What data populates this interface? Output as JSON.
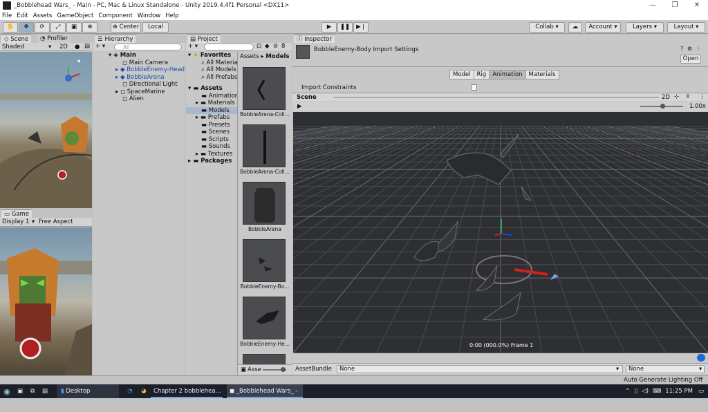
{
  "window": {
    "title": "_Bobblehead Wars_ - Main - PC, Mac & Linux Standalone - Unity 2019.4.4f1 Personal <DX11>",
    "controls": [
      "—",
      "❐",
      "✕"
    ]
  },
  "menu": [
    "File",
    "Edit",
    "Assets",
    "GameObject",
    "Component",
    "Window",
    "Help"
  ],
  "toolbar": {
    "pivot_label": "Center",
    "space_label": "Local",
    "collab_label": "Collab ▾",
    "account_label": "Account",
    "layers_label": "Layers",
    "layout_label": "Layout"
  },
  "scene_panel": {
    "tab_scene": "Scene",
    "tab_profiler": "Profiler",
    "shading_mode": "Shaded",
    "mode_2d": "2D"
  },
  "game_panel": {
    "tab": "Game",
    "display": "Display 1",
    "aspect": "Free Aspect"
  },
  "hierarchy": {
    "tab": "Hierarchy",
    "search_placeholder": "All",
    "root": "Main",
    "items": [
      "Main Camera",
      "BobbleEnemy-Head",
      "BobbleArena",
      "Directional Light",
      "SpaceMarine",
      "Alien"
    ]
  },
  "project": {
    "tab": "Project",
    "breadcrumb_root": "Assets",
    "breadcrumb_current": "Models",
    "favorites_label": "Favorites",
    "favorites": [
      "All Materia",
      "All Models",
      "All Prefabs"
    ],
    "assets_label": "Assets",
    "folders": [
      "Animations",
      "Materials",
      "Models",
      "Prefabs",
      "Presets",
      "Scenes",
      "Scripts",
      "Sounds",
      "Textures"
    ],
    "packages_label": "Packages",
    "thumbnails": [
      "BobbleArena-Coll...",
      "BobbleArena-Coll...",
      "BobbleArena",
      "BobbleEnemy-Bo...",
      "BobbleEnemy-He..."
    ],
    "footer_label": "Asse",
    "count_badge": "8"
  },
  "inspector": {
    "tab": "Inspector",
    "title": "BobbleEnemy-Body Import Settings",
    "open_button": "Open",
    "tabs": [
      "Model",
      "Rig",
      "Animation",
      "Materials"
    ],
    "active_tab": "Animation",
    "import_constraints_label": "Import Constraints",
    "preview_label": "Scene",
    "preview_mode_2d": "2D",
    "playback_speed": "1.00x",
    "time_readout": "0:00 (000.0%) Frame 1",
    "assetbundle_label": "AssetBundle",
    "assetbundle_value": "None",
    "assetbundle_variant": "None"
  },
  "status_bar": {
    "lighting": "Auto Generate Lighting Off"
  },
  "taskbar": {
    "desktop_label": "Desktop",
    "chrome_task": "Chapter 2 bobblehea...",
    "unity_task": "_Bobblehead Wars_ - ...",
    "time": "11:25 PM"
  },
  "colors": {
    "selection_blue": "#1a4fa8",
    "taskbar_bg": "#1b1f29",
    "viewport_bg": "#2e2f32"
  }
}
